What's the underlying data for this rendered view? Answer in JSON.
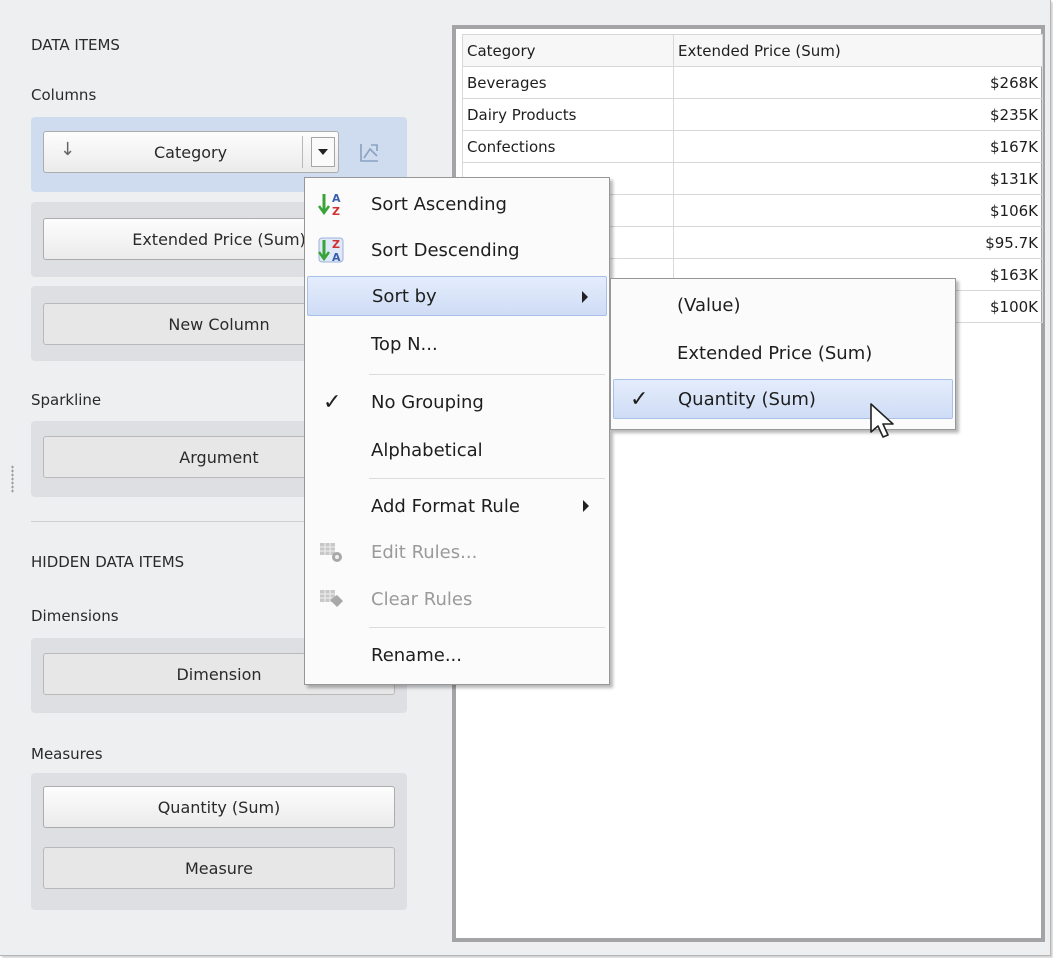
{
  "panel": {
    "data_items_header": "DATA ITEMS",
    "columns_label": "Columns",
    "category_button": "Category",
    "extended_price_button": "Extended Price (Sum)",
    "new_column_button": "New Column",
    "sparkline_label": "Sparkline",
    "argument_button": "Argument",
    "hidden_header": "HIDDEN DATA ITEMS",
    "dimensions_label": "Dimensions",
    "dimension_button": "Dimension",
    "measures_label": "Measures",
    "quantity_button": "Quantity (Sum)",
    "measure_button": "Measure"
  },
  "grid": {
    "headers": [
      "Category",
      "Extended Price (Sum)"
    ],
    "rows": [
      [
        "Beverages",
        "$268K"
      ],
      [
        "Dairy Products",
        "$235K"
      ],
      [
        "Confections",
        "$167K"
      ],
      [
        "",
        "$131K"
      ],
      [
        "",
        "$106K"
      ],
      [
        "",
        "$95.7K"
      ],
      [
        "",
        "$163K"
      ],
      [
        "",
        "$100K"
      ]
    ]
  },
  "context_menu": {
    "sort_ascending": "Sort Ascending",
    "sort_descending": "Sort Descending",
    "sort_by": "Sort by",
    "top_n": "Top N...",
    "no_grouping": "No Grouping",
    "alphabetical": "Alphabetical",
    "add_format_rule": "Add Format Rule",
    "edit_rules": "Edit Rules...",
    "clear_rules": "Clear Rules",
    "rename": "Rename..."
  },
  "submenu": {
    "value": "(Value)",
    "extended_price": "Extended Price (Sum)",
    "quantity": "Quantity (Sum)"
  },
  "icons": [
    "sort-down-arrow-icon",
    "dropdown-arrow-icon",
    "sparkline-toggle-icon",
    "sort-ascending-icon",
    "sort-descending-icon",
    "checkmark-icon",
    "edit-rules-icon",
    "clear-rules-icon",
    "mouse-cursor-icon"
  ],
  "colors": {
    "selected_row": "#d4dff0",
    "highlight": "#cfdcf5",
    "accent_green": "#3aa33a",
    "accent_red": "#d03030"
  }
}
